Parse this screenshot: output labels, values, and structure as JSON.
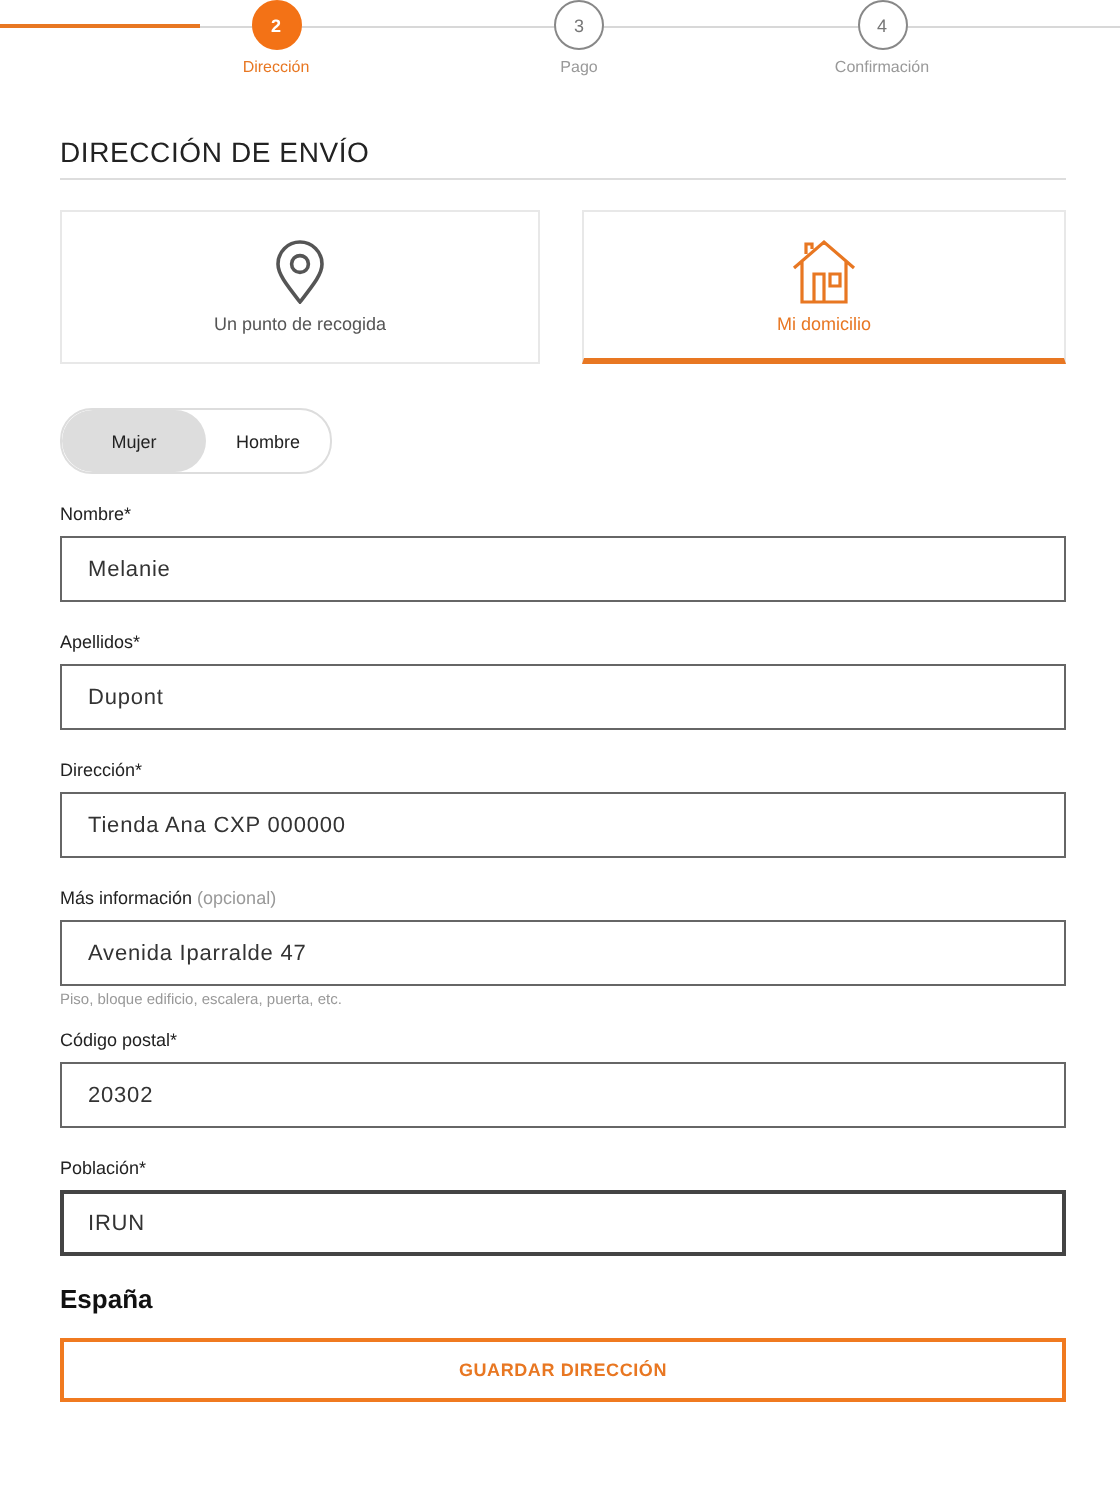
{
  "steps": [
    {
      "number": "2",
      "label": "Dirección",
      "selected": true
    },
    {
      "number": "3",
      "label": "Pago",
      "selected": false
    },
    {
      "number": "4",
      "label": "Confirmación",
      "selected": false
    }
  ],
  "section_title": "DIRECCIÓN DE ENVÍO",
  "delivery_options": [
    {
      "kind": "pickup",
      "label": "Un punto de recogida",
      "selected": false
    },
    {
      "kind": "home",
      "label": "Mi domicilio",
      "selected": true
    }
  ],
  "gender_toggle": [
    {
      "label": "Mujer",
      "selected": true
    },
    {
      "label": "Hombre",
      "selected": false
    }
  ],
  "fields": [
    {
      "label": "Nombre*",
      "value": "Melanie",
      "focused": false
    },
    {
      "label": "Apellidos*",
      "value": "Dupont",
      "focused": false
    },
    {
      "label": "Dirección*",
      "value": "Tienda Ana CXP 000000",
      "focused": false
    },
    {
      "label": "Más información",
      "optional_note": "(opcional)",
      "value": "Avenida Iparralde 47",
      "hint": "Piso, bloque edificio, escalera, puerta, etc.",
      "focused": false
    },
    {
      "label": "Código postal*",
      "value": "20302",
      "focused": false
    },
    {
      "label": "Población*",
      "value": "IRUN",
      "focused": true
    }
  ],
  "country": "España",
  "save_button": "GUARDAR DIRECCIÓN"
}
